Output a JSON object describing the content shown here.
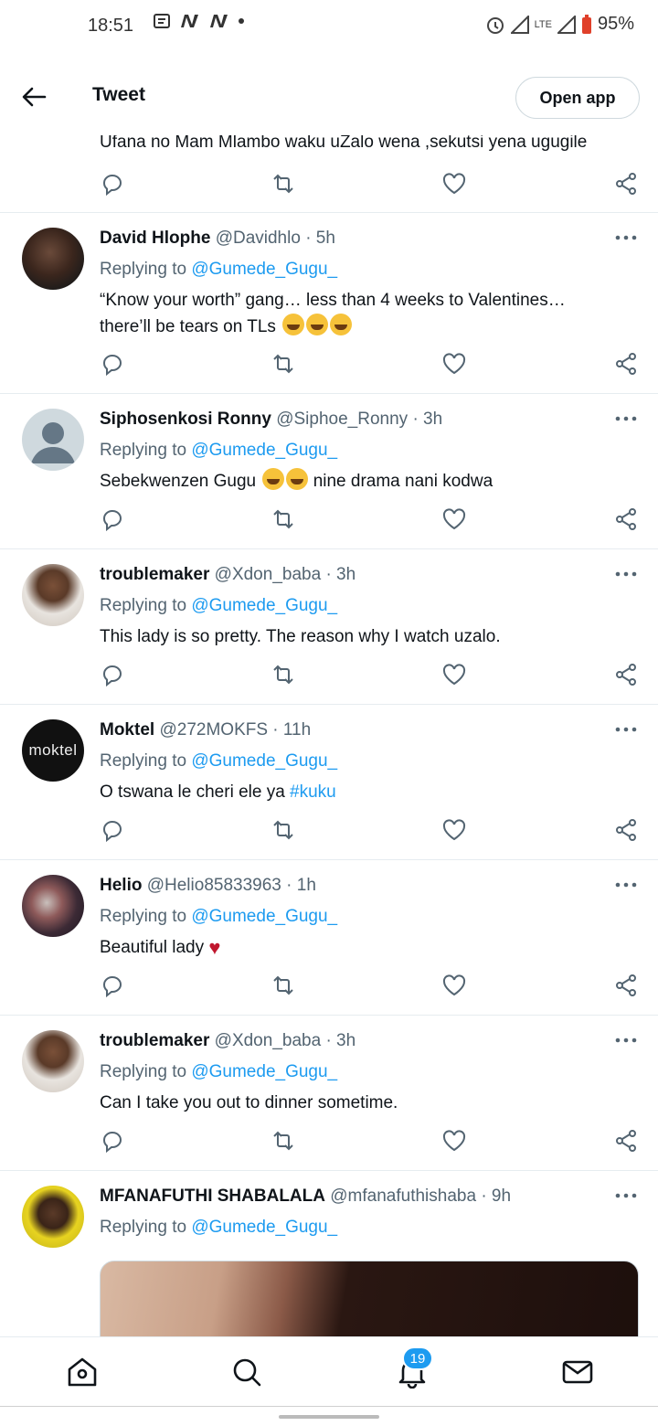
{
  "status_bar": {
    "time": "18:51",
    "battery": "95%",
    "network": "LTE"
  },
  "header": {
    "title": "Tweet",
    "open_app": "Open app"
  },
  "partial_tweet": {
    "text": "Ufana no Mam Mlambo waku uZalo wena ,sekutsi yena ugugile"
  },
  "replying_to_label": "Replying to",
  "tweets": [
    {
      "name": "David Hlophe",
      "handle": "@Davidhlo",
      "time": "· 5h",
      "reply_to": "@Gumede_Gugu_",
      "text1": "“Know your worth” gang… less than 4 weeks to Valentines…",
      "text2": "there’ll be tears on TLs"
    },
    {
      "name": "Siphosenkosi Ronny",
      "handle": "@Siphoe_Ronny",
      "time": "· 3h",
      "reply_to": "@Gumede_Gugu_",
      "text_a": "Sebekwenzen Gugu",
      "text_b": "nine drama nani kodwa"
    },
    {
      "name": "troublemaker",
      "handle": "@Xdon_baba",
      "time": "· 3h",
      "reply_to": "@Gumede_Gugu_",
      "text": "This lady is so pretty. The reason why I watch uzalo."
    },
    {
      "name": "Moktel",
      "handle": "@272MOKFS",
      "time": "· 11h",
      "reply_to": "@Gumede_Gugu_",
      "text": "O tswana le cheri ele ya",
      "hashtag": "#kuku",
      "avatar_text": "moktel"
    },
    {
      "name": "Helio",
      "handle": "@Helio85833963",
      "time": "· 1h",
      "reply_to": "@Gumede_Gugu_",
      "text": "Beautiful lady",
      "heart": "♥"
    },
    {
      "name": "troublemaker",
      "handle": "@Xdon_baba",
      "time": "· 3h",
      "reply_to": "@Gumede_Gugu_",
      "text": "Can I take you out to dinner sometime."
    },
    {
      "name": "MFANAFUTHI SHABALALA",
      "handle": "@mfanafuthishaba",
      "time": "· 9h",
      "reply_to": "@Gumede_Gugu_"
    }
  ],
  "bottom_nav": {
    "notifications_badge": "19"
  },
  "icons": [
    "back-arrow-icon",
    "reply-icon",
    "retweet-icon",
    "like-icon",
    "share-icon",
    "more-icon",
    "home-icon",
    "search-icon",
    "notifications-icon",
    "messages-icon"
  ],
  "colors": {
    "accent": "#1d9bf0",
    "text": "#0f1419",
    "secondary": "#536471",
    "divider": "#e6ecf0"
  }
}
